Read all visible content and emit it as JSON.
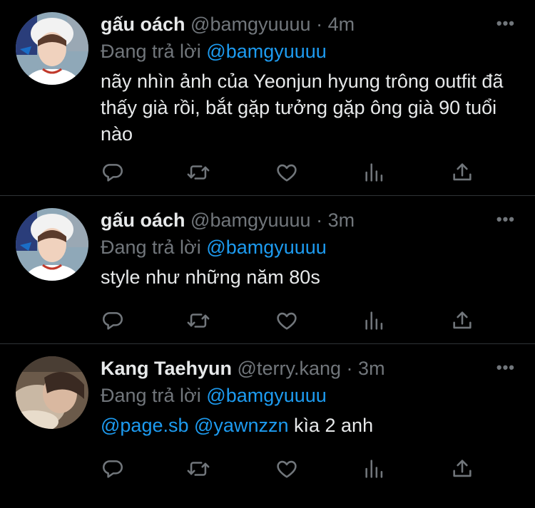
{
  "tweets": [
    {
      "name": "gấu oách",
      "handle": "@bamgyuuuu",
      "dot": "·",
      "time": "4m",
      "replying_prefix": "Đang trả lời",
      "replying_to": "@bamgyuuuu",
      "text": "nãy nhìn ảnh của Yeonjun hyung trông outfit đã thấy già rồi, bắt gặp tưởng gặp ông già 90 tuổi nào",
      "more": "•••"
    },
    {
      "name": "gấu oách",
      "handle": "@bamgyuuuu",
      "dot": "·",
      "time": "3m",
      "replying_prefix": "Đang trả lời",
      "replying_to": "@bamgyuuuu",
      "text": "style như những năm 80s",
      "more": "•••"
    },
    {
      "name": "Kang Taehyun",
      "handle": "@terry.kang",
      "dot": "·",
      "time": "3m",
      "replying_prefix": "Đang trả lời",
      "replying_to": "@bamgyuuuu",
      "mention_1": "@page.sb",
      "mention_2": "@yawnzzn",
      "text_rest": "kìa 2 anh",
      "more": "•••"
    }
  ],
  "icons": [
    "reply-icon",
    "retweet-icon",
    "like-icon",
    "views-icon",
    "share-icon"
  ],
  "colors": {
    "background": "#000000",
    "text": "#e7e9ea",
    "secondary": "#71767b",
    "link": "#1d9bf0",
    "divider": "#2f3336"
  }
}
